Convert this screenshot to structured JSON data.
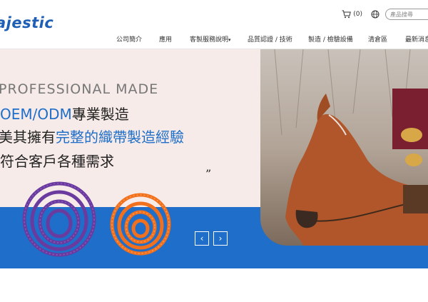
{
  "header": {
    "logo": "ajestic",
    "cart_count": "(0)",
    "search_placeholder": "產品搜尋"
  },
  "nav": {
    "items": [
      "公司簡介",
      "應用",
      "客製服務說明",
      "品質認證 / 技術",
      "製造 / 檢驗設備",
      "清倉區",
      "最新消息"
    ],
    "dropdown_mark": "▾"
  },
  "hero": {
    "line1": "PROFESSIONAL MADE",
    "line2_a": "OEM/ODM",
    "line2_b": "專業製造",
    "line3_a": "美其擁有",
    "line3_b": "完整的織帶製造經驗",
    "line4": "符合客戶各種需求",
    "quote": "”"
  },
  "slider": {
    "prev_glyph": "‹",
    "next_glyph": "›"
  },
  "colors": {
    "brand": "#1f5fb6",
    "bar": "#1f6ec9",
    "hero_bg": "#f6ebe8",
    "rope_purple": "#6a3a9e",
    "rope_orange": "#f0701e"
  }
}
